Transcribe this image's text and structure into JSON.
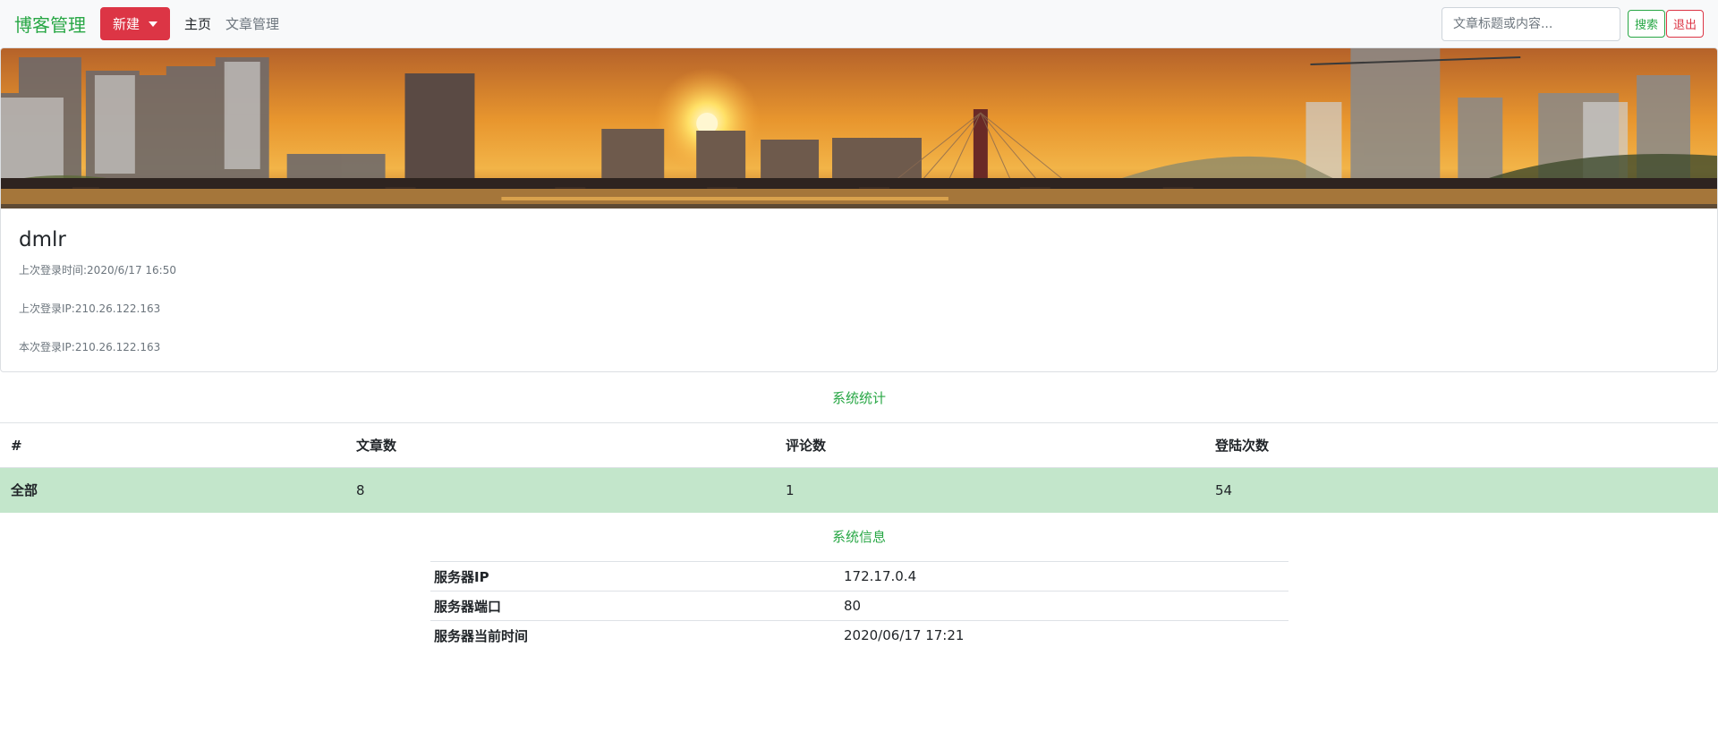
{
  "navbar": {
    "brand": "博客管理",
    "new_label": "新建",
    "home_label": "主页",
    "articles_label": "文章管理",
    "search_placeholder": "文章标题或内容...",
    "search_label": "搜索",
    "logout_label": "退出"
  },
  "profile": {
    "username": "dmlr",
    "last_login_time": "上次登录时间:2020/6/17 16:50",
    "last_login_ip": "上次登录IP:210.26.122.163",
    "current_login_ip": "本次登录IP:210.26.122.163"
  },
  "stats": {
    "title": "系统统计",
    "headers": [
      "#",
      "文章数",
      "评论数",
      "登陆次数"
    ],
    "row": {
      "label": "全部",
      "articles": "8",
      "comments": "1",
      "logins": "54"
    }
  },
  "sysinfo": {
    "title": "系统信息",
    "rows": [
      {
        "key": "服务器IP",
        "value": "172.17.0.4"
      },
      {
        "key": "服务器端口",
        "value": "80"
      },
      {
        "key": "服务器当前时间",
        "value": "2020/06/17 17:21"
      }
    ]
  },
  "colors": {
    "accent": "#28a745",
    "danger": "#dc3545",
    "success_row": "#c3e6cb"
  }
}
